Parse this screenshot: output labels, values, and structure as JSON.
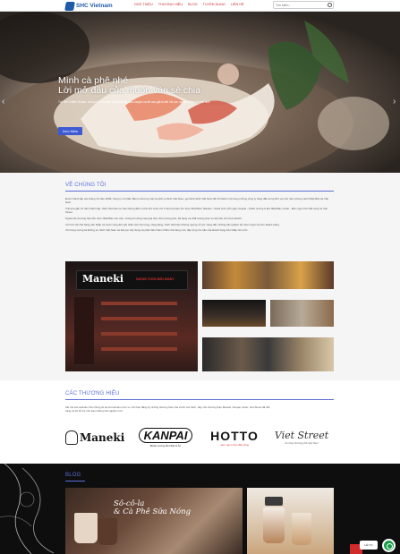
{
  "header": {
    "logo_text": "SHC Vietnam",
    "nav": [
      "GIỚI THIỆU",
      "THƯƠNG HIỆU",
      "BLOG",
      "TUYỂN DỤNG",
      "LIÊN HỆ"
    ],
    "search_placeholder": "Tìm kiếm..."
  },
  "hero": {
    "title_line1": "Mình cà phê nhé",
    "title_line2": "Lời mở đầu của muôn vàn sẻ chia",
    "subtitle": "Tại The Coffee House, chúng tôi luôn trân trọng những câu chuyện và đề cao giá trị kết nối con người. Mình cà phê nhé!",
    "button_label": "Xem thêm",
    "prev_arrow": "‹",
    "next_arrow": "›"
  },
  "about": {
    "title": "VỀ CHÚNG TÔI",
    "paragraphs": [
      "Được thành lập vào tháng 12 năm 2008, Công ty cổ phần đầu tư thương mại và dịch vụ SHC Việt Nam, gọi tắt là SHC Việt Nam đã trở thành một trong những công ty hàng đầu trong lĩnh vực ẩm thực phong cách Nhật Bản tại Việt Nam.",
      "Trải qua gần 13 năm thành lập, SHC Việt Nam tự hào không định vị thế của mình với 4 thương hiệu Ẩm thực Nhật Bản: Maneki - Sushi tươi mỗi ngày, Kanpai - buffet nướng & lẩu Nhật Bản, Hotto - Món ngon trên đĩa nóng và Viet Street.",
      "Ngoài các thương hiệu ẩm thực Nhật Bản nêu trên, chúng tôi cũng mang lại thực đơn phong phú, đa dạng và chất lượng phục vụ tận tâm cho thực khách.",
      "Với hơn 30 nhà hàng trên khắp cả nước cùng đội ngũ nhân viên trẻ trung, năng động, SHC Việt Nam không ngừng nỗ lực mang đến những trải nghiệm ẩm thực tuyệt vời cho khách hàng.",
      "Với trong tương lai không xa, SHC Việt Nam sẽ tiếp tục xây dựng và phát triển thêm nhiều nhà hàng mới, đáp ứng nhu cầu của khách hàng trên khắp cả nước."
    ],
    "maneki_sign": "Maneki",
    "maneki_tagline": "SUSHI TƯƠI MỖI NGÀY"
  },
  "brands": {
    "title": "CÁC THƯƠNG HIỆU",
    "text": "Kết nối các website cửa chúng tôi tại shcvietnam.com.vn. Khi bạn đăng ký những thương hiệu của chính các SHC, hãy như thương hiệu Maneki, Kanpai, Hotto, Viet Street đã sẵn sàng và sẽ hỗ trợ cho bạn những trải nghiệm mới.",
    "logos": [
      {
        "name": "Maneki",
        "sub": ""
      },
      {
        "name": "KANPAI",
        "sub": "Buffet nướng lẩu Nhật & Âu"
      },
      {
        "name": "HOTTO",
        "sub": "món ngon trên đĩa nóng"
      },
      {
        "name": "Viet Street",
        "sub": "Ẩm thực đường phố Việt Nam"
      }
    ]
  },
  "blog": {
    "title": "BLOG",
    "card1_text_line1": "Sô-cô-la",
    "card1_text_line2": "& Cà Phê Sữa Nóng",
    "chat_label": "Hỏi TC",
    "colors": {
      "accent": "#5b6fd6",
      "chat": "#1a9c4a",
      "nav": "#c62a2a"
    }
  }
}
